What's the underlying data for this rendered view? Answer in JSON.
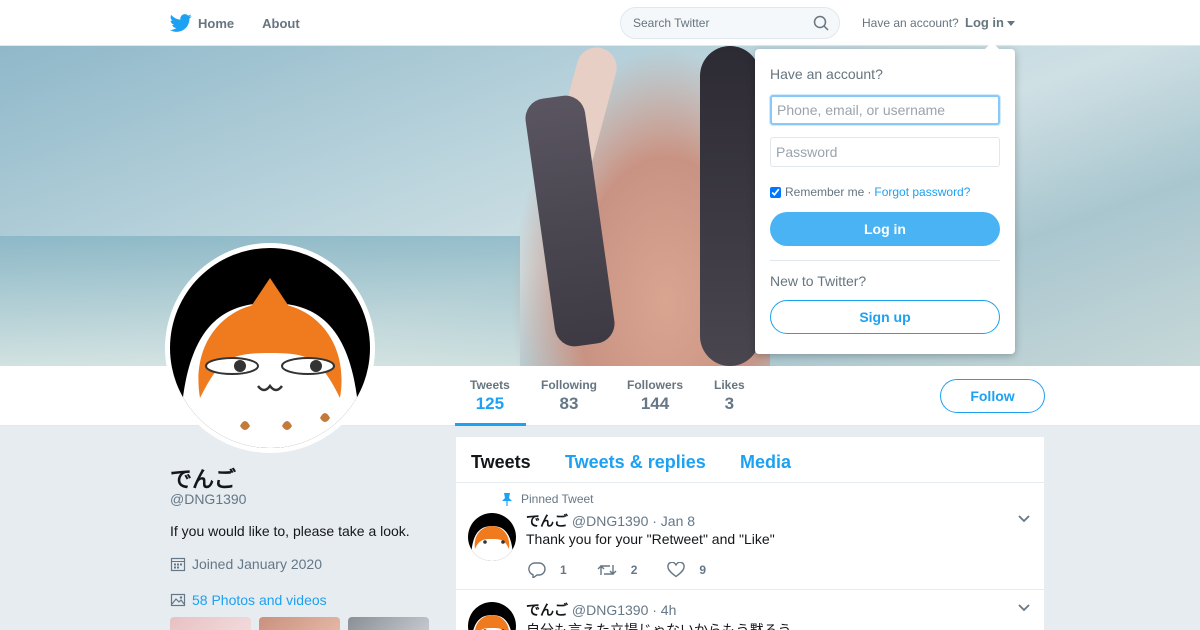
{
  "nav": {
    "home_label": "Home",
    "about_label": "About",
    "search_placeholder": "Search Twitter",
    "have_account": "Have an account?",
    "login_label": "Log in"
  },
  "profile": {
    "name": "でんご",
    "handle": "@DNG1390",
    "bio": "If you would like to, please take a look.",
    "joined": "Joined January 2020",
    "photos_label": "58 Photos and videos",
    "follow_label": "Follow",
    "stats": [
      {
        "label": "Tweets",
        "value": "125",
        "active": true
      },
      {
        "label": "Following",
        "value": "83"
      },
      {
        "label": "Followers",
        "value": "144"
      },
      {
        "label": "Likes",
        "value": "3"
      }
    ]
  },
  "timeline": {
    "tabs": [
      "Tweets",
      "Tweets & replies",
      "Media"
    ],
    "tweets": [
      {
        "pinned_label": "Pinned Tweet",
        "name": "でんご",
        "handle": "@DNG1390",
        "time": "· Jan 8",
        "text": "Thank you for your \"Retweet\" and \"Like\"",
        "replies": "1",
        "retweets": "2",
        "likes": "9"
      },
      {
        "name": "でんご",
        "handle": "@DNG1390",
        "time": "· 4h",
        "text": "自分も言えた立場じゃないからもう黙ろう"
      }
    ]
  },
  "login_dropdown": {
    "title": "Have an account?",
    "username_placeholder": "Phone, email, or username",
    "password_placeholder": "Password",
    "remember_label": "Remember me",
    "separator": "·",
    "forgot_label": "Forgot password?",
    "login_button": "Log in",
    "new_label": "New to Twitter?",
    "signup_button": "Sign up"
  },
  "colors": {
    "accent": "#1da1f2",
    "background": "#e6ecf0",
    "login_button": "#4ab3f4"
  }
}
